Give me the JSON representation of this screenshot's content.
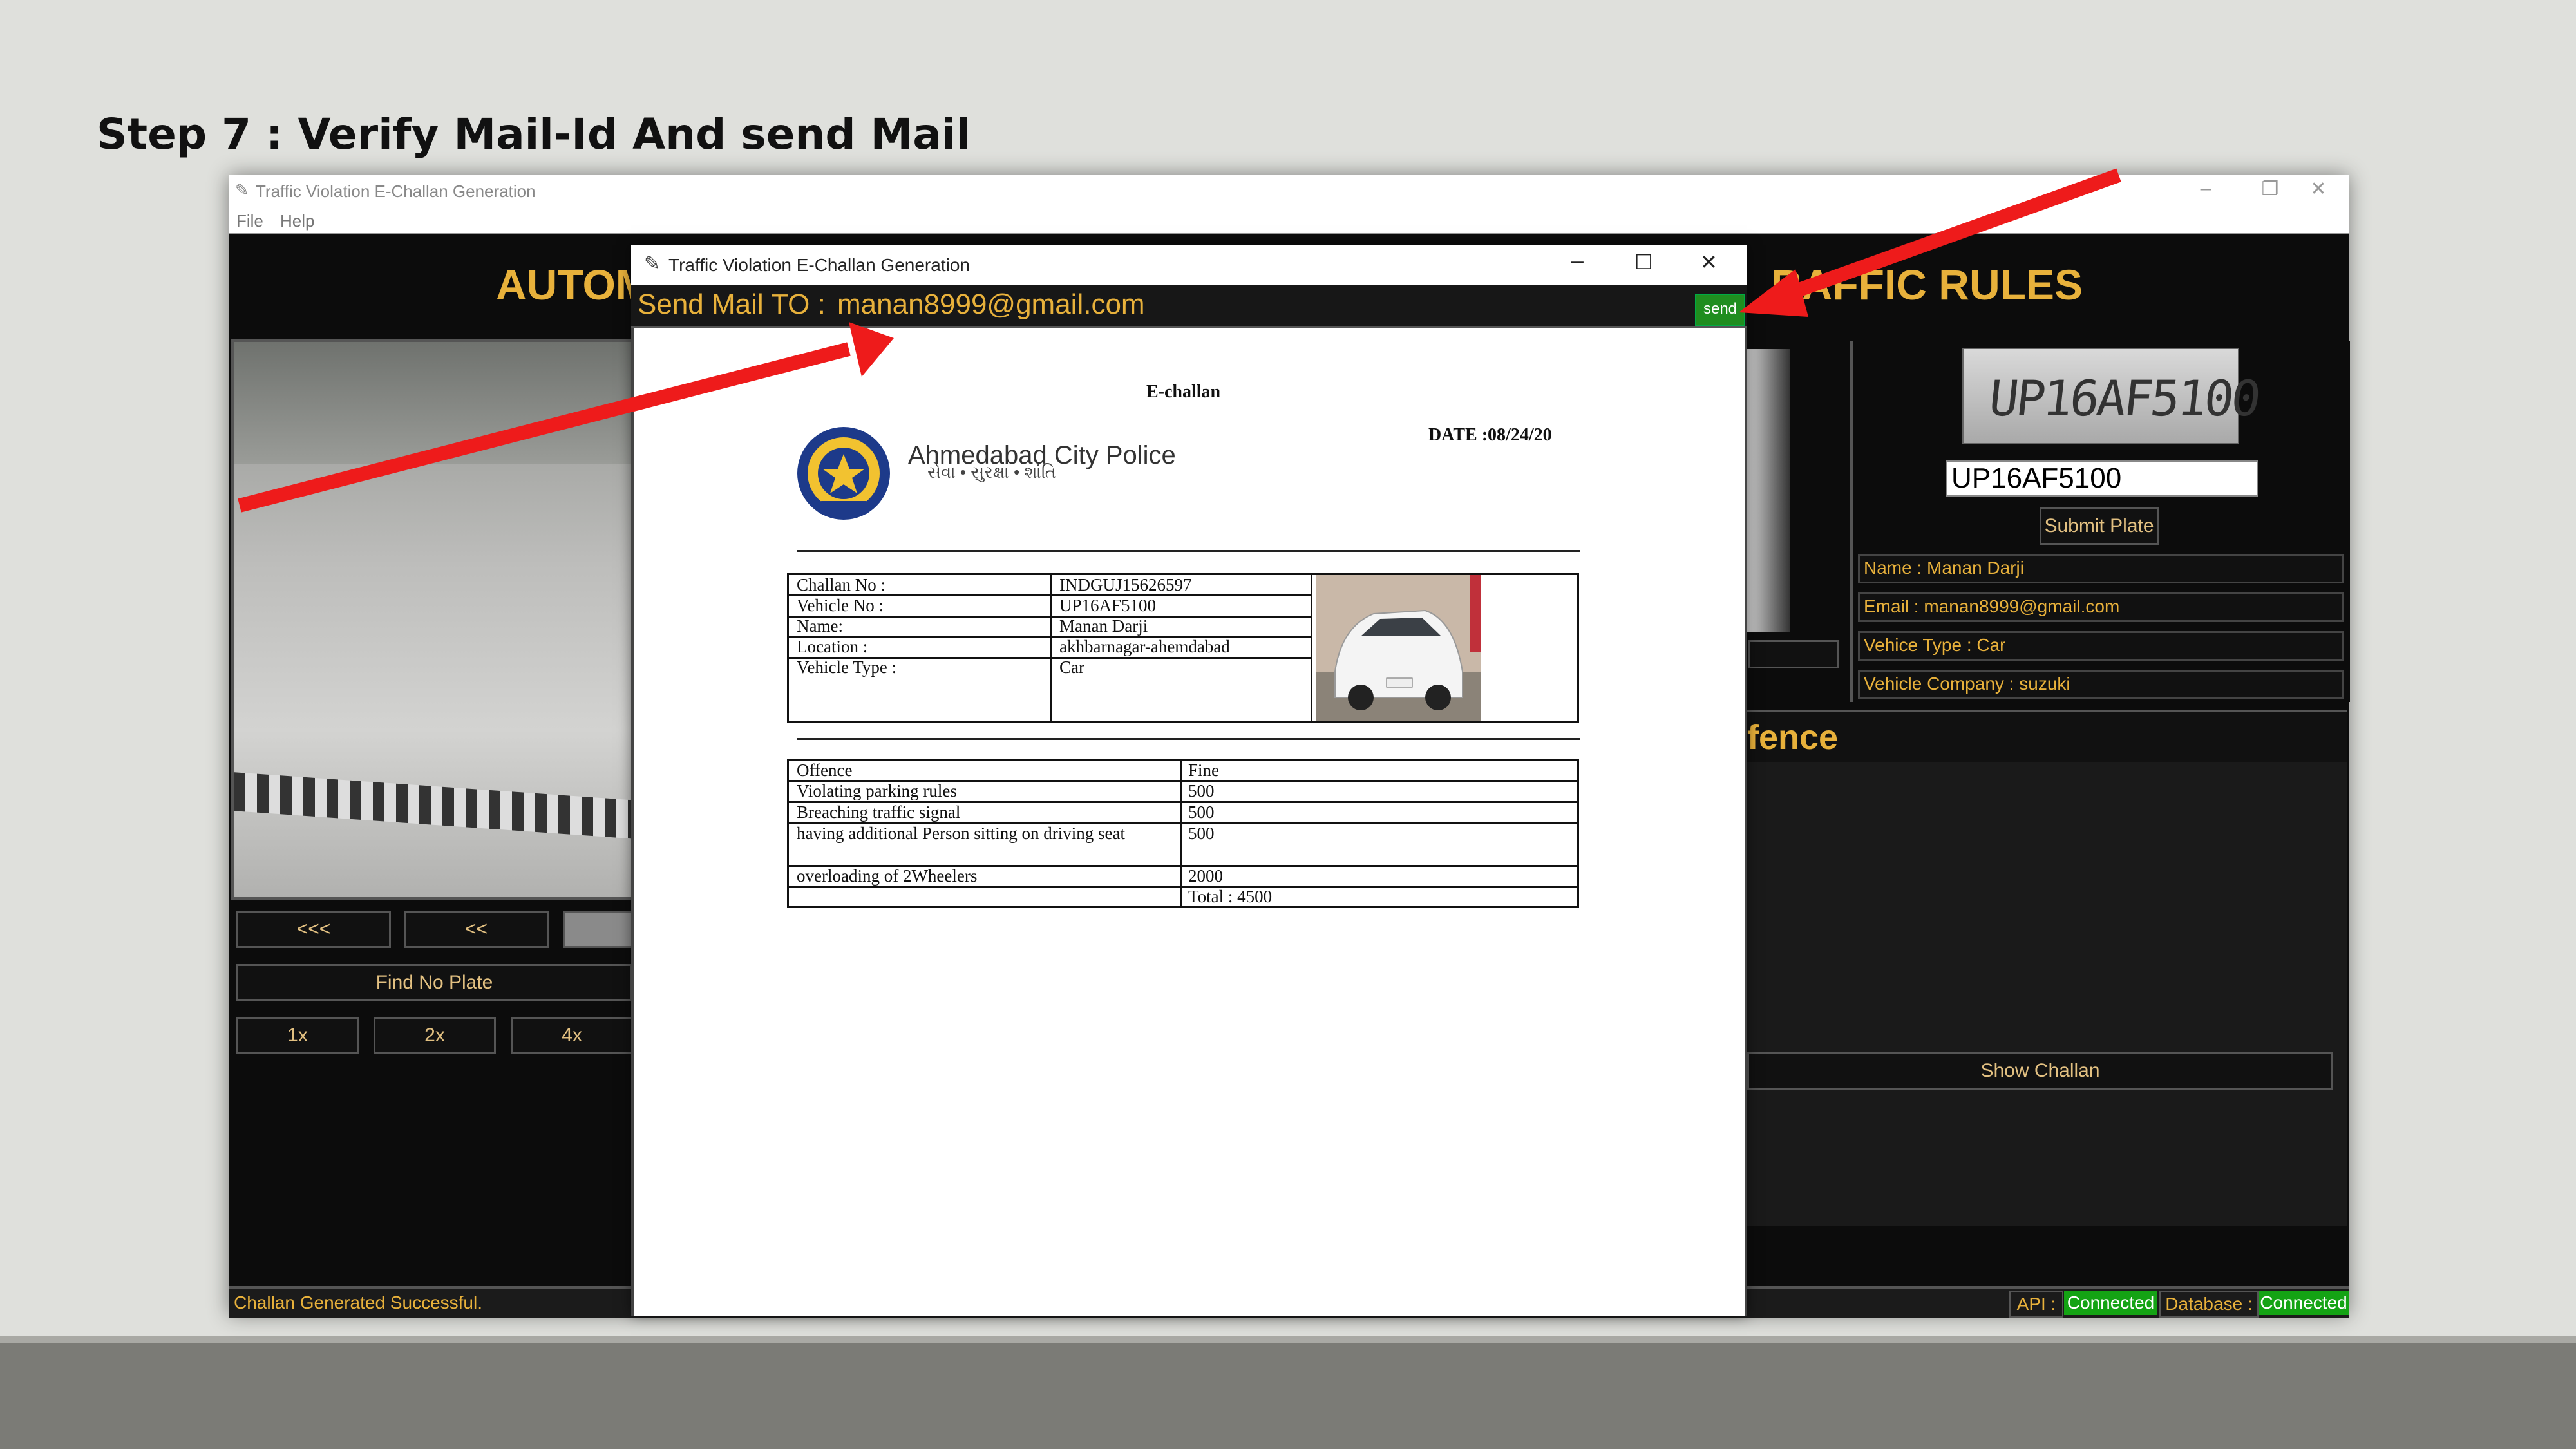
{
  "slide": {
    "title": "Step 7 : Verify Mail-Id And send Mail"
  },
  "main_window": {
    "title": "Traffic Violation E-Challan Generation",
    "menu": [
      "File",
      "Help"
    ],
    "header_left": "AUTOM",
    "header_right": "RAFFIC RULES",
    "nav_buttons": [
      "<<<",
      "<<"
    ],
    "find_plate_button": "Find No Plate",
    "speed_buttons": [
      "1x",
      "2x",
      "4x"
    ],
    "plate_image_text": "UP16AF5100",
    "plate_input_value": "UP16AF5100",
    "submit_plate_button": "Submit Plate",
    "info_fields": [
      "Name : Manan Darji",
      "Email : manan8999@gmail.com",
      "Vehice Type : Car",
      "Vehicle Company : suzuki"
    ],
    "offence_header": "fence",
    "show_challan_button": "Show Challan",
    "status_text": "Challan Generated Successful.",
    "status_api_label": "API :",
    "status_api_value": "Connected",
    "status_db_label": "Database :",
    "status_db_value": "Connected"
  },
  "dialog": {
    "title": "Traffic Violation E-Challan Generation",
    "mail_label": "Send Mail TO :",
    "mail_address": "manan8999@gmail.com",
    "send_button": "send",
    "challan": {
      "heading": "E-challan",
      "date": "DATE :08/24/20",
      "police_name": "Ahmedabad City Police",
      "police_motto": "સેવા • સુરક્ષા • શાંતિ",
      "details": [
        {
          "label": "Challan No :",
          "value": "INDGUJ15626597"
        },
        {
          "label": "Vehicle No :",
          "value": "UP16AF5100"
        },
        {
          "label": "Name:",
          "value": "Manan Darji"
        },
        {
          "label": "Location :",
          "value": "akhbarnagar-ahemdabad"
        },
        {
          "label": "Vehicle Type :",
          "value": "Car"
        }
      ],
      "offence_header": {
        "offence": "Offence",
        "fine": "Fine"
      },
      "offences": [
        {
          "offence": "Violating parking rules",
          "fine": "500"
        },
        {
          "offence": "Breaching traffic signal",
          "fine": "500"
        },
        {
          "offence": "having additional Person sitting on driving seat",
          "fine": "500"
        },
        {
          "offence": "overloading of 2Wheelers",
          "fine": "2000"
        }
      ],
      "total": "Total : 4500"
    }
  },
  "colors": {
    "accent_gold": "#e8b13b",
    "send_green": "#1f8d1f",
    "status_green": "#14a314",
    "arrow_red": "#ee1b1b"
  }
}
